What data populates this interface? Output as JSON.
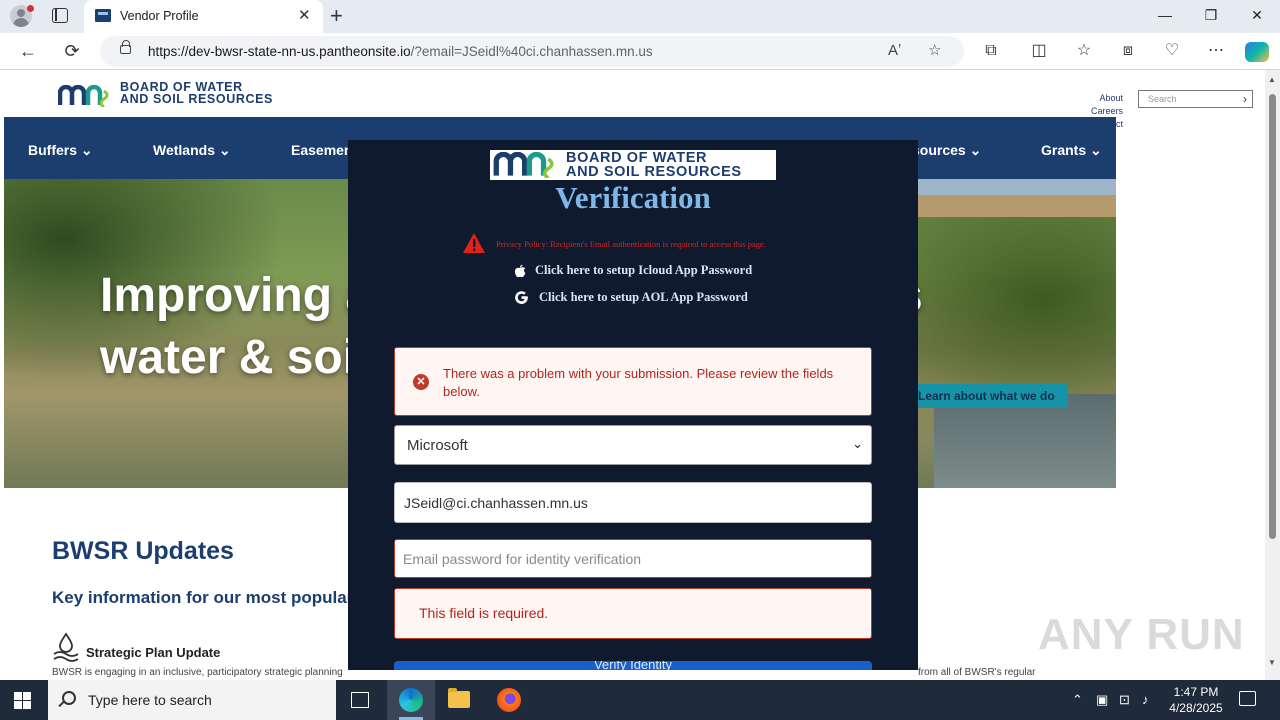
{
  "browser": {
    "tab_title": "Vendor Profile",
    "tab_close": "✕",
    "new_tab": "+",
    "url_host": "https://dev-bwsr-state-nn-us.pantheonsite.io",
    "url_rest": "/?email=JSeidl%40ci.chanhassen.mn.us",
    "window_controls": {
      "minimize": "—",
      "maximize": "❐",
      "close": "✕"
    },
    "nav": {
      "back": "←",
      "refresh": "⟳"
    }
  },
  "site": {
    "logo_line1": "BOARD OF WATER",
    "logo_line2": "AND SOIL RESOURCES",
    "top_links": [
      "About",
      "Careers",
      "ct"
    ],
    "search_placeholder": "Search",
    "nav_items": [
      {
        "label": "Buffers ⌄"
      },
      {
        "label": "Wetlands ⌄"
      },
      {
        "label": "Easemen"
      },
      {
        "label": "sources ⌄"
      },
      {
        "label": "Grants ⌄"
      }
    ],
    "hero_line1": "Improving a",
    "hero_line2": "water & soil",
    "hero_right": "s",
    "hero_cta": "Learn about what we do",
    "updates_heading": "BWSR Updates",
    "updates_sub": "Key information for our most popular",
    "plan_title": "Strategic Plan Update",
    "plan_body": "BWSR is engaging in an inclusive, participatory strategic planning",
    "right_body": "from all of BWSR's regular",
    "watermark": "ANY RUN"
  },
  "modal": {
    "logo_line1": "BOARD OF WATER",
    "logo_line2": "AND SOIL RESOURCES",
    "title": "Verification",
    "privacy_text": "Privacy Policy: Recipient's Email authentication is required to access this page.",
    "icloud_link": "Click here to setup Icloud App Password",
    "aol_link": "Click here to setup AOL App Password",
    "error_message": "There was a problem with your submission. Please review the fields below.",
    "provider_selected": "Microsoft",
    "email_value": "JSeidl@ci.chanhassen.mn.us",
    "password_placeholder": "Email password for identity verification",
    "field_error": "This field is required.",
    "verify_button": "Verify Identity",
    "colors": {
      "background": "#0f1a2e",
      "title": "#7fb7e6",
      "error": "#c0392b",
      "button": "#1a5fc7"
    }
  },
  "taskbar": {
    "search_text": "Type here to search",
    "time": "1:47 PM",
    "date": "4/28/2025",
    "apps": [
      "task-view-icon",
      "edge-icon",
      "file-explorer-icon",
      "firefox-icon"
    ]
  }
}
